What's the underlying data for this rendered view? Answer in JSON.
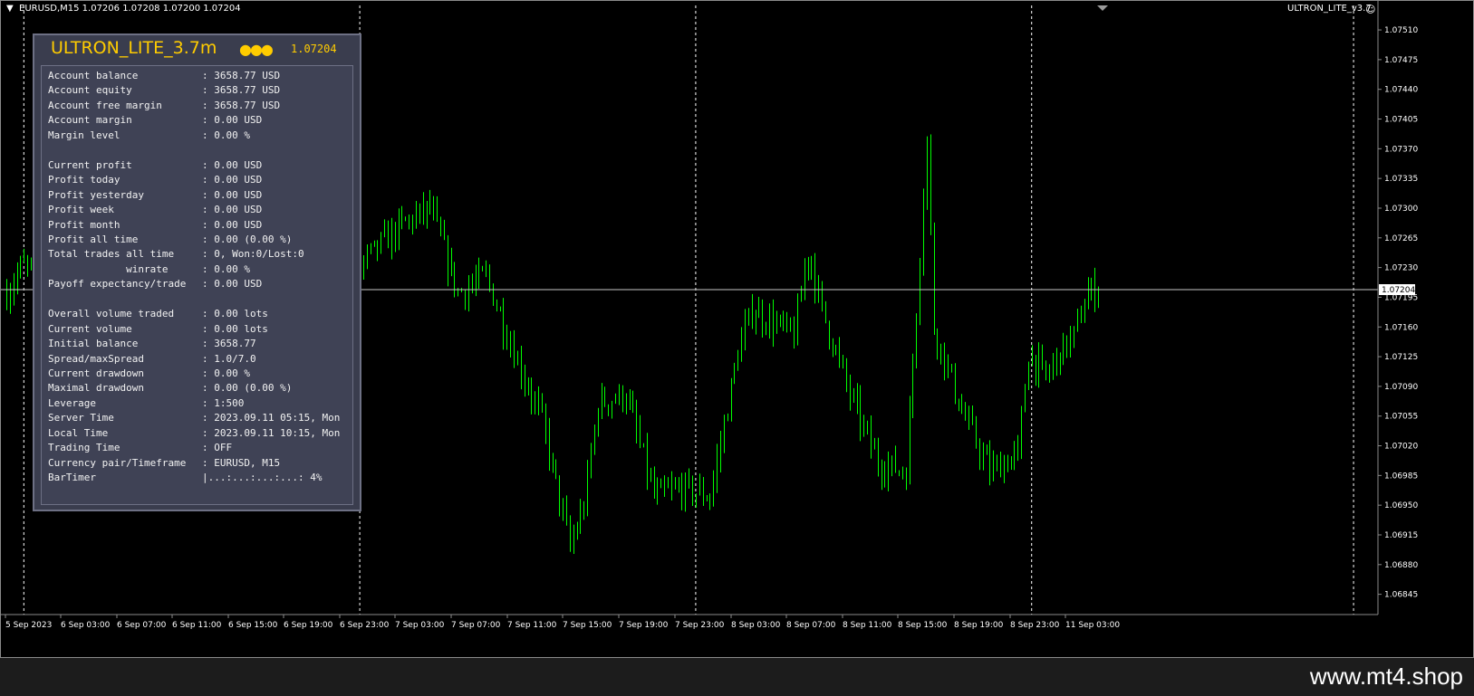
{
  "chart": {
    "symbol_info": "EURUSD,M15  1.07206 1.07208 1.07200 1.07204",
    "indicator_name": "ULTRON_LITE_v3.7",
    "current_price_label": "1.07204",
    "colors": {
      "candles": "#00ff00",
      "grid": "#ffffff",
      "price_line": "#c0c0c0",
      "axis_text": "#ffffff"
    }
  },
  "chart_data": {
    "type": "candlestick",
    "price_axis_ticks": [
      "1.07510",
      "1.07475",
      "1.07440",
      "1.07405",
      "1.07370",
      "1.07335",
      "1.07300",
      "1.07265",
      "1.07230",
      "1.07195",
      "1.07160",
      "1.07125",
      "1.07090",
      "1.07055",
      "1.07020",
      "1.06985",
      "1.06950",
      "1.06915",
      "1.06880",
      "1.06845"
    ],
    "time_axis_ticks": [
      "5 Sep 2023",
      "6 Sep 03:00",
      "6 Sep 07:00",
      "6 Sep 11:00",
      "6 Sep 15:00",
      "6 Sep 19:00",
      "6 Sep 23:00",
      "7 Sep 03:00",
      "7 Sep 07:00",
      "7 Sep 11:00",
      "7 Sep 15:00",
      "7 Sep 19:00",
      "7 Sep 23:00",
      "8 Sep 03:00",
      "8 Sep 07:00",
      "8 Sep 11:00",
      "8 Sep 15:00",
      "8 Sep 19:00",
      "8 Sep 23:00",
      "11 Sep 03:00"
    ],
    "ylim": [
      1.06835,
      1.07525
    ],
    "current_price": 1.07204,
    "period_separators": [
      "6 Sep 00:00",
      "7 Sep 00:00",
      "8 Sep 00:00",
      "11 Sep 00:00",
      "11 Sep 23:00"
    ],
    "close_path": [
      {
        "t": "5 Sep 22:45",
        "v": 1.072
      },
      {
        "t": "5 Sep 23:45",
        "v": 1.0723
      },
      {
        "t": "6 Sep 19:45",
        "v": 1.0724
      },
      {
        "t": "6 Sep 23:45",
        "v": 1.0723
      },
      {
        "t": "7 Sep 03:00",
        "v": 1.0728
      },
      {
        "t": "7 Sep 05:00",
        "v": 1.073
      },
      {
        "t": "7 Sep 07:00",
        "v": 1.072
      },
      {
        "t": "7 Sep 09:00",
        "v": 1.0722
      },
      {
        "t": "7 Sep 11:00",
        "v": 1.0713
      },
      {
        "t": "7 Sep 13:00",
        "v": 1.0705
      },
      {
        "t": "7 Sep 15:00",
        "v": 1.069
      },
      {
        "t": "7 Sep 16:00",
        "v": 1.0695
      },
      {
        "t": "7 Sep 17:00",
        "v": 1.0707
      },
      {
        "t": "7 Sep 19:00",
        "v": 1.0708
      },
      {
        "t": "7 Sep 21:00",
        "v": 1.0696
      },
      {
        "t": "7 Sep 23:00",
        "v": 1.0697
      },
      {
        "t": "8 Sep 01:00",
        "v": 1.0696
      },
      {
        "t": "8 Sep 03:00",
        "v": 1.0713
      },
      {
        "t": "8 Sep 04:00",
        "v": 1.0718
      },
      {
        "t": "8 Sep 05:00",
        "v": 1.0717
      },
      {
        "t": "8 Sep 07:00",
        "v": 1.0715
      },
      {
        "t": "8 Sep 08:00",
        "v": 1.0725
      },
      {
        "t": "8 Sep 09:00",
        "v": 1.0718
      },
      {
        "t": "8 Sep 11:00",
        "v": 1.0708
      },
      {
        "t": "8 Sep 13:00",
        "v": 1.07
      },
      {
        "t": "8 Sep 15:00",
        "v": 1.0699
      },
      {
        "t": "8 Sep 15:30",
        "v": 1.0712
      },
      {
        "t": "8 Sep 16:30",
        "v": 1.0738
      },
      {
        "t": "8 Sep 17:00",
        "v": 1.0716
      },
      {
        "t": "8 Sep 19:00",
        "v": 1.0706
      },
      {
        "t": "8 Sep 21:00",
        "v": 1.0699
      },
      {
        "t": "8 Sep 23:00",
        "v": 1.0701
      },
      {
        "t": "8 Sep 23:45",
        "v": 1.0713
      },
      {
        "t": "11 Sep 01:00",
        "v": 1.071
      },
      {
        "t": "11 Sep 02:00",
        "v": 1.0713
      },
      {
        "t": "11 Sep 03:00",
        "v": 1.0715
      },
      {
        "t": "11 Sep 04:00",
        "v": 1.072
      },
      {
        "t": "11 Sep 04:45",
        "v": 1.07204
      }
    ],
    "grid": false
  },
  "panel": {
    "title": "ULTRON_LITE_3.7m",
    "price": "1.07204",
    "rows": [
      {
        "label": "Account balance",
        "value": ": 3658.77 USD"
      },
      {
        "label": "Account equity",
        "value": ": 3658.77 USD"
      },
      {
        "label": "Account free margin",
        "value": ": 3658.77 USD"
      },
      {
        "label": "Account margin",
        "value": ": 0.00 USD"
      },
      {
        "label": "Margin level",
        "value": ": 0.00 %"
      },
      {
        "label": "",
        "value": ""
      },
      {
        "label": "Current profit",
        "value": ": 0.00 USD"
      },
      {
        "label": "Profit today",
        "value": ": 0.00 USD"
      },
      {
        "label": "Profit yesterday",
        "value": ": 0.00 USD"
      },
      {
        "label": "Profit week",
        "value": ": 0.00 USD"
      },
      {
        "label": "Profit month",
        "value": ": 0.00 USD"
      },
      {
        "label": "Profit all time",
        "value": ": 0.00 (0.00 %)"
      },
      {
        "label": "Total trades all time",
        "value": ": 0, Won:0/Lost:0"
      },
      {
        "label": "             winrate",
        "value": ": 0.00 %"
      },
      {
        "label": "Payoff expectancy/trade",
        "value": ": 0.00 USD"
      },
      {
        "label": "",
        "value": ""
      },
      {
        "label": "Overall volume traded",
        "value": ": 0.00 lots"
      },
      {
        "label": "Current volume",
        "value": ": 0.00 lots"
      },
      {
        "label": "Initial balance",
        "value": ": 3658.77"
      },
      {
        "label": "Spread/maxSpread",
        "value": ": 1.0/7.0"
      },
      {
        "label": "Current drawdown",
        "value": ": 0.00 %"
      },
      {
        "label": "Maximal drawdown",
        "value": ": 0.00 (0.00 %)"
      },
      {
        "label": "Leverage",
        "value": ": 1:500"
      },
      {
        "label": "Server Time",
        "value": ": 2023.09.11 05:15, Mon"
      },
      {
        "label": "Local Time",
        "value": ": 2023.09.11 10:15, Mon"
      },
      {
        "label": "Trading Time",
        "value": ": OFF"
      },
      {
        "label": "Currency pair/Timeframe",
        "value": ": EURUSD, M15"
      },
      {
        "label": "BarTimer",
        "value": "|...:...:...:...: 4%"
      }
    ]
  },
  "footer": {
    "site": "www.mt4.shop"
  }
}
